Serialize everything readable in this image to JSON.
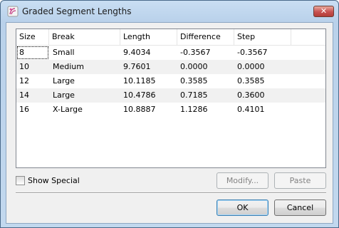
{
  "window": {
    "title": "Graded Segment Lengths",
    "close_glyph": "✕"
  },
  "table": {
    "columns": [
      "Size",
      "Break",
      "Length",
      "Difference",
      "Step",
      ""
    ],
    "rows": [
      [
        "8",
        "Small",
        "9.4034",
        "-0.3567",
        "-0.3567"
      ],
      [
        "10",
        "Medium",
        "9.7601",
        "0.0000",
        "0.0000"
      ],
      [
        "12",
        "Large",
        "10.1185",
        "0.3585",
        "0.3585"
      ],
      [
        "14",
        "Large",
        "10.4786",
        "0.7185",
        "0.3600"
      ],
      [
        "16",
        "X-Large",
        "10.8887",
        "1.1286",
        "0.4101"
      ]
    ]
  },
  "options": {
    "show_special_label": "Show Special",
    "show_special_checked": false
  },
  "buttons": {
    "modify": "Modify...",
    "paste": "Paste",
    "ok": "OK",
    "cancel": "Cancel"
  },
  "icons": {
    "app": "sewing-pattern-icon",
    "close": "close-icon"
  }
}
